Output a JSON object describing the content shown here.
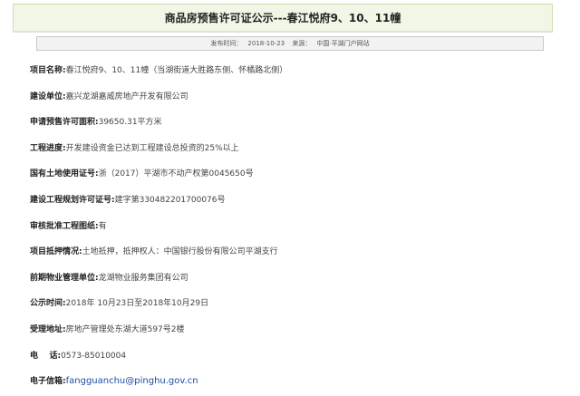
{
  "article": {
    "title": "商品房预售许可证公示---春江悦府9、10、11幢",
    "meta": {
      "date_label": "发布时间：",
      "date": "2018-10-23",
      "source_label": "来源：",
      "source": "中国·平湖门户网站"
    },
    "fields": [
      {
        "label": "项目名称:",
        "value": "春江悦府9、10、11幢（当湖街道大胜路东侧、怀橘路北侧）"
      },
      {
        "label": "建设单位:",
        "value": "嘉兴龙湖嘉威房地产开发有限公司"
      },
      {
        "label": "申请预售许可面积:",
        "value": "39650.31平方米"
      },
      {
        "label": "工程进度:",
        "value": "开发建设资金已达到工程建设总投资的25%以上"
      },
      {
        "label": "国有土地使用证号:",
        "value": "浙（2017）平湖市不动产权第0045650号"
      },
      {
        "label": "建设工程规划许可证号:",
        "value": "建字第330482201700076号"
      },
      {
        "label": "审核批准工程图纸:",
        "value": "有"
      },
      {
        "label": "项目抵押情况:",
        "value": "土地抵押，抵押权人：中国银行股份有限公司平湖支行"
      },
      {
        "label": "前期物业管理单位:",
        "value": "龙湖物业服务集团有公司"
      },
      {
        "label": "公示时间:",
        "value": "2018年 10月23日至2018年10月29日"
      },
      {
        "label": "受理地址:",
        "value": "房地产管理处东湖大道597号2楼"
      },
      {
        "label": "电    话:",
        "value": "0573-85010004"
      },
      {
        "label": "电子信箱:",
        "value": "fangguanchu@pinghu.gov.cn"
      }
    ]
  }
}
